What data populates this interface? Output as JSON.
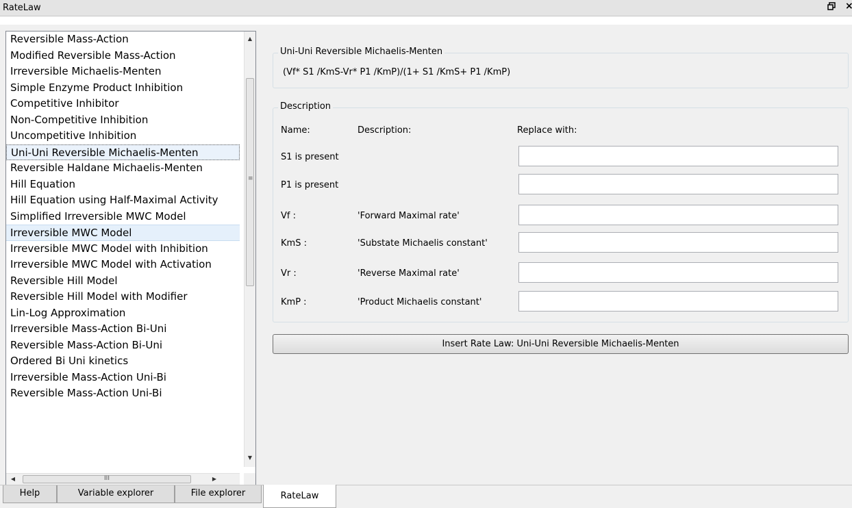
{
  "window": {
    "title": "RateLaw",
    "float_icon": "restore-icon",
    "close_icon": "close-icon"
  },
  "list": {
    "items": [
      "Reversible Mass-Action",
      "Modified Reversible Mass-Action",
      "Irreversible Michaelis-Menten",
      "Simple Enzyme Product Inhibition",
      "Competitive Inhibitor",
      "Non-Competitive Inhibition",
      " Uncompetitive Inhibition",
      "Uni-Uni Reversible Michaelis-Menten",
      "Reversible Haldane Michaelis-Menten",
      "Hill Equation",
      "Hill Equation using Half-Maximal Activity",
      "Simplified Irreversible MWC Model",
      "Irreversible MWC Model",
      "Irreversible MWC Model with Inhibition",
      "Irreversible MWC Model with Activation",
      "Reversible Hill Model",
      "Reversible Hill Model with Modifier",
      "Lin-Log Approximation",
      "Irreversible Mass-Action Bi-Uni",
      "Reversible Mass-Action Bi-Uni",
      "Ordered Bi Uni kinetics",
      "Irreversible Mass-Action Uni-Bi",
      "Reversible Mass-Action Uni-Bi"
    ],
    "selected_index": 7,
    "hover_index": 12,
    "hscroll_grip": "III"
  },
  "law": {
    "group_title": "Uni-Uni Reversible Michaelis-Menten",
    "formula": "(Vf* S1 /KmS-Vr* P1 /KmP)/(1+ S1 /KmS+ P1 /KmP)"
  },
  "description": {
    "group_title": "Description",
    "headers": {
      "name": "Name:",
      "description": "Description:",
      "replace": "Replace with:"
    },
    "rows": [
      {
        "name": "S1 is present",
        "description": "",
        "value": ""
      },
      {
        "name": "P1 is present",
        "description": "",
        "value": ""
      },
      {
        "name": "Vf :",
        "description": "'Forward Maximal rate'",
        "value": ""
      },
      {
        "name": "KmS :",
        "description": "'Substate Michaelis constant'",
        "value": ""
      },
      {
        "name": "Vr :",
        "description": "'Reverse Maximal rate'",
        "value": ""
      },
      {
        "name": "KmP :",
        "description": "'Product Michaelis constant'",
        "value": ""
      }
    ]
  },
  "insert_button": "Insert Rate Law: Uni-Uni Reversible Michaelis-Menten",
  "tabs": [
    "Help",
    "Variable explorer",
    "File explorer",
    "RateLaw"
  ],
  "active_tab": 3
}
